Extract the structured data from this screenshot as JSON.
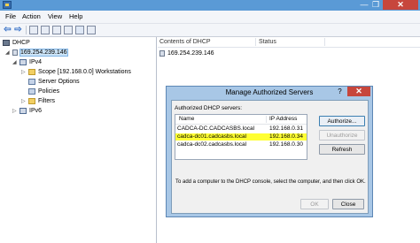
{
  "window": {
    "min_icon": "—",
    "max_icon": "❐",
    "close_icon": "✕"
  },
  "menu": {
    "items": [
      "File",
      "Action",
      "View",
      "Help"
    ]
  },
  "toolbar": {
    "back_icon": "⇦",
    "forward_icon": "⇨"
  },
  "tree": {
    "root": "DHCP",
    "server": "169.254.239.146",
    "ipv4": "IPv4",
    "scope": "Scope [192.168.0.0] Workstations",
    "server_options": "Server Options",
    "policies": "Policies",
    "filters": "Filters",
    "ipv6": "IPv6"
  },
  "content": {
    "column_contents": "Contents of DHCP",
    "column_status": "Status",
    "rows": [
      "169.254.239.146"
    ]
  },
  "dialog": {
    "title": "Manage Authorized Servers",
    "help_icon": "?",
    "close_icon": "✕",
    "list_label": "Authorized DHCP servers:",
    "col_name": "Name",
    "col_ip": "IP Address",
    "servers": [
      {
        "name": "CADCA-DC.CADCASBS.local",
        "ip": "192.168.0.31",
        "highlighted": false
      },
      {
        "name": "cadca-dc01.cadcasbs.local",
        "ip": "192.168.0.34",
        "highlighted": true
      },
      {
        "name": "cadca-dc02.cadcasbs.local",
        "ip": "192.168.0.30",
        "highlighted": false
      }
    ],
    "authorize_label": "Authorize...",
    "unauthorize_label": "Unauthorize",
    "refresh_label": "Refresh",
    "instruction": "To add a computer to the DHCP console, select the computer, and then click OK.",
    "ok_label": "OK",
    "close_label": "Close"
  },
  "colors": {
    "highlight": "#ffff33",
    "titlebar": "#5a9ad6",
    "dialog_frame": "#a8c7e6",
    "close_red": "#c7463c"
  }
}
